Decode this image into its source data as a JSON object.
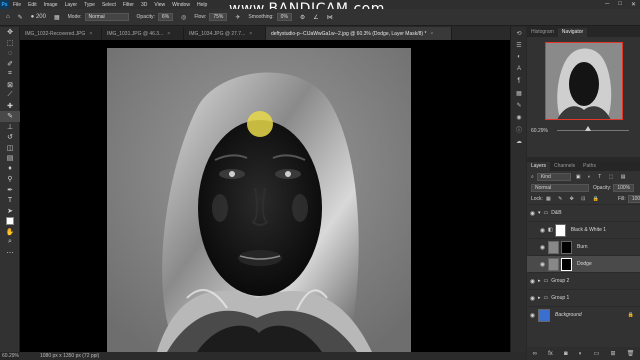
{
  "menu": {
    "items": [
      "File",
      "Edit",
      "Image",
      "Layer",
      "Type",
      "Select",
      "Filter",
      "3D",
      "View",
      "Window",
      "Help"
    ],
    "logo": "Ps"
  },
  "watermark": "www.BANDICAM.com",
  "options_bar": {
    "brush_size": "200",
    "mode_label": "Mode:",
    "mode_value": "Normal",
    "opacity_label": "Opacity:",
    "opacity_value": "6%",
    "flow_label": "Flow:",
    "flow_value": "75%",
    "smoothing_label": "Smoothing:",
    "smoothing_value": "0%"
  },
  "tabs": [
    {
      "label": "IMG_1032-Recovered.JPG",
      "active": false
    },
    {
      "label": "IMG_1031.JPG @ 46.3...",
      "active": false
    },
    {
      "label": "IMG_1034.JPG @ 27.7...",
      "active": false
    },
    {
      "label": "deftystudio-p--CIJaWwGa1w--2.jpg @ 60.3% (Dodge, Layer Mask/8) *",
      "active": true
    }
  ],
  "status": {
    "zoom": "60.29%",
    "doc_info": "1080 px x 1350 px (72 ppi)"
  },
  "navigator": {
    "tabs": [
      "Histogram",
      "Navigator"
    ],
    "active_tab": "Navigator",
    "zoom": "60.29%"
  },
  "layers_panel": {
    "tabs": [
      "Layers",
      "Channels",
      "Paths"
    ],
    "active_tab": "Layers",
    "filter_kind": "Kind",
    "blend_mode": "Normal",
    "opacity_label": "Opacity:",
    "opacity_value": "100%",
    "lock_label": "Lock:",
    "fill_label": "Fill:",
    "fill_value": "100%",
    "layers": [
      {
        "name": "D&B",
        "type": "group",
        "visible": true,
        "selected": false
      },
      {
        "name": "Black & White 1",
        "type": "adjustment",
        "visible": true,
        "selected": false
      },
      {
        "name": "Burn",
        "type": "layer",
        "visible": true,
        "selected": false
      },
      {
        "name": "Dodge",
        "type": "layer",
        "visible": true,
        "selected": true
      },
      {
        "name": "Group 2",
        "type": "group",
        "visible": true,
        "selected": false
      },
      {
        "name": "Group 1",
        "type": "group",
        "visible": true,
        "selected": false
      },
      {
        "name": "Background",
        "type": "background",
        "visible": true,
        "selected": false
      }
    ]
  },
  "colors": {
    "accent_selection": "#4a4a4a",
    "nav_box": "#e2382c",
    "brush_cursor": "#e8d84a"
  }
}
